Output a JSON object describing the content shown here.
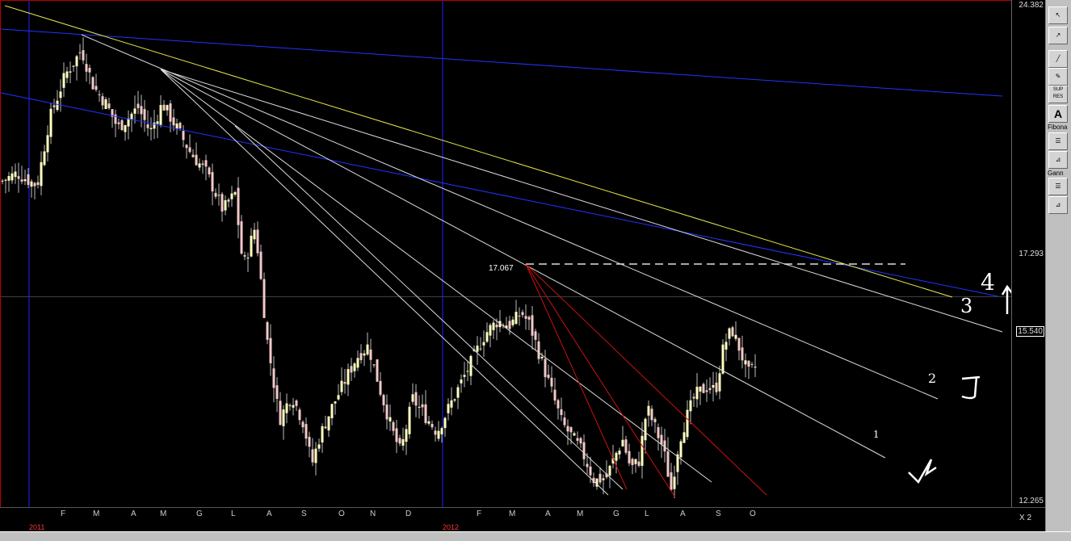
{
  "chart_data": {
    "type": "candlestick",
    "ylim": [
      12.265,
      24.382
    ],
    "y_ticks": [
      "24.382",
      "17.293",
      "15.540",
      "12.265"
    ],
    "current_price": "15.540",
    "months": [
      "F",
      "M",
      "A",
      "M",
      "G",
      "L",
      "A",
      "S",
      "O",
      "N",
      "D",
      "F",
      "M",
      "A",
      "M",
      "G",
      "L",
      "A",
      "S",
      "O"
    ],
    "years": [
      "2011",
      "2012"
    ],
    "peak_annotation": "17.067",
    "handwritten": [
      "4",
      "3",
      "2",
      "1"
    ],
    "zoom": "X 2"
  },
  "toolbar": {
    "sup_res": "SUP RES",
    "text_tool": "A",
    "fibonacci": "Fibona",
    "gann": "Gann"
  }
}
